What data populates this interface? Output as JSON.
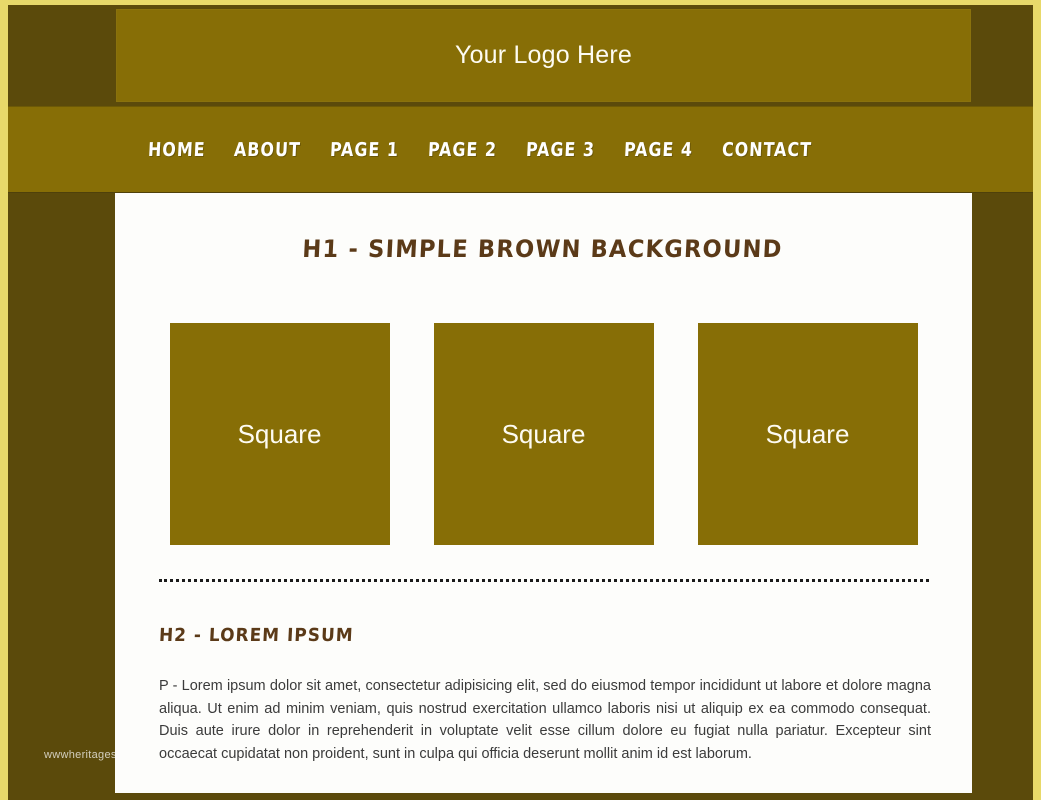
{
  "theme": {
    "frame_border": "#e8d96a",
    "background_dark": "#5b4a0b",
    "accent_gold": "#876e06",
    "panel_white": "#fdfdfb",
    "heading_brown": "#5b3a18",
    "nav_text": "#ffffff"
  },
  "header": {
    "logo_text": "Your Logo Here"
  },
  "nav": {
    "items": [
      {
        "label": "HOME"
      },
      {
        "label": "ABOUT"
      },
      {
        "label": "PAGE 1"
      },
      {
        "label": "PAGE 2"
      },
      {
        "label": "PAGE 3"
      },
      {
        "label": "PAGE 4"
      },
      {
        "label": "CONTACT"
      }
    ]
  },
  "main": {
    "h1": "H1 - SIMPLE BROWN BACKGROUND",
    "squares": [
      {
        "label": "Square"
      },
      {
        "label": "Square"
      },
      {
        "label": "Square"
      }
    ],
    "h2": "H2 - LOREM IPSUM",
    "paragraph": "P - Lorem ipsum dolor sit amet, consectetur adipisicing elit, sed do eiusmod tempor incididunt ut labore et dolore magna aliqua. Ut enim ad minim veniam, quis nostrud exercitation ullamco laboris nisi ut aliquip ex ea commodo consequat. Duis aute irure dolor in reprehenderit in voluptate velit esse cillum dolore eu fugiat nulla pariatur. Excepteur sint occaecat cupidatat non proident, sunt in culpa qui officia deserunt mollit anim id est laborum."
  },
  "watermark": {
    "text": "wwwheritages"
  }
}
